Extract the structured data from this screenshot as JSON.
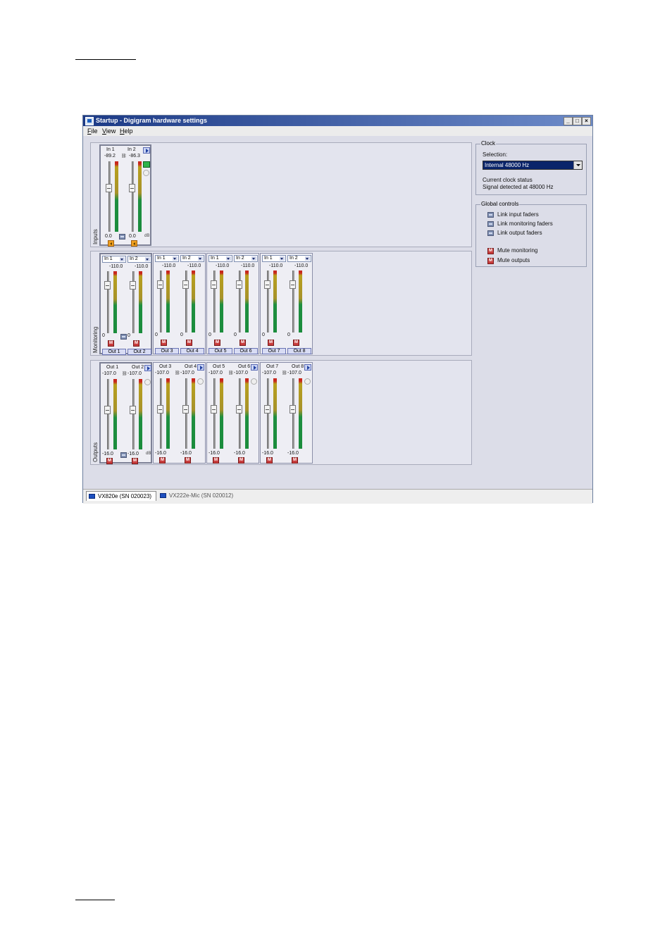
{
  "window": {
    "title": "Startup - Digigram hardware settings",
    "btn_min": "_",
    "btn_max": "□",
    "btn_close": "×"
  },
  "menu": [
    "File",
    "View",
    "Help"
  ],
  "sections": {
    "inputs": "Inputs",
    "monitoring": "Monitoring",
    "outputs": "Outputs"
  },
  "inputs": {
    "channels": [
      "In 1",
      "In 2"
    ],
    "levels": [
      "-89.2",
      "-86.3"
    ],
    "gains": [
      "0.0",
      "0.0"
    ],
    "db": "dB"
  },
  "monitoring": {
    "strips": [
      {
        "sources": [
          "In 1",
          "In 2"
        ],
        "outs": [
          "Out 1",
          "Out 2"
        ]
      },
      {
        "sources": [
          "In 1",
          "In 2"
        ],
        "outs": [
          "Out 3",
          "Out 4"
        ]
      },
      {
        "sources": [
          "In 1",
          "In 2"
        ],
        "outs": [
          "Out 5",
          "Out 6"
        ]
      },
      {
        "sources": [
          "In 1",
          "In 2"
        ],
        "outs": [
          "Out 7",
          "Out 8"
        ]
      }
    ],
    "level": "-110.0",
    "gain": "0"
  },
  "outputs": {
    "strips": [
      {
        "channels": [
          "Out 1",
          "Out 2"
        ]
      },
      {
        "channels": [
          "Out 3",
          "Out 4"
        ]
      },
      {
        "channels": [
          "Out 5",
          "Out 6"
        ]
      },
      {
        "channels": [
          "Out 7",
          "Out 8"
        ]
      }
    ],
    "level": "-107.0",
    "gain": "-16.0",
    "db": "dB"
  },
  "mute_label": "M",
  "clock": {
    "title": "Clock",
    "selection_label": "Selection:",
    "selected": "Internal 48000 Hz",
    "status_label": "Current clock status",
    "status_value": "Signal detected at 48000 Hz"
  },
  "global": {
    "title": "Global controls",
    "items": [
      "Link input faders",
      "Link monitoring faders",
      "Link output faders",
      "Mute monitoring",
      "Mute outputs"
    ]
  },
  "tabs": [
    "VX820e (SN 020023)",
    "VX222e-Mic (SN 020012)"
  ]
}
